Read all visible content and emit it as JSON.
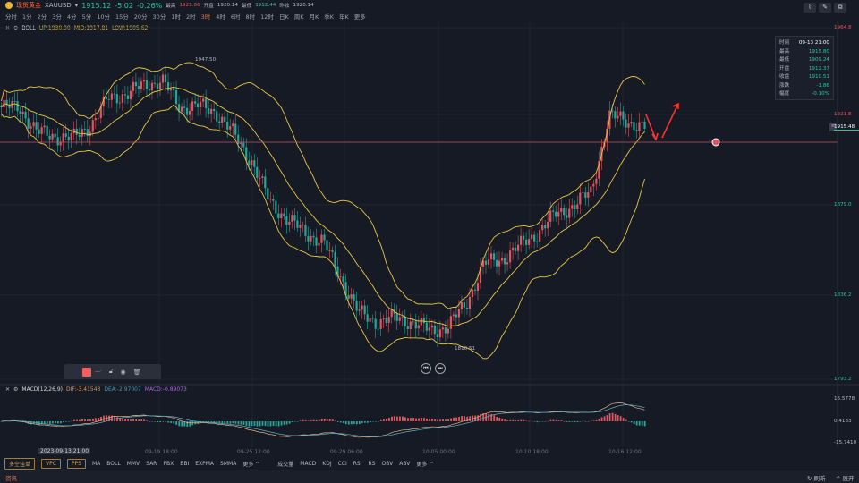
{
  "header": {
    "name": "现货黄金",
    "symbol": "XAUUSD",
    "price": "1915.12",
    "change": "-5.02",
    "change_pct": "-0.26%",
    "high_label": "最高",
    "high": "1921.86",
    "open_label": "开盘",
    "open": "1920.14",
    "low_label": "最低",
    "low": "1912.44",
    "prev_label": "昨收",
    "prev": "1920.14"
  },
  "timeframes": [
    "分时",
    "1分",
    "2分",
    "3分",
    "4分",
    "5分",
    "10分",
    "15分",
    "20分",
    "30分",
    "1时",
    "2时",
    "3时",
    "4时",
    "6时",
    "8时",
    "12时",
    "日K",
    "周K",
    "月K",
    "季K",
    "年K",
    "更多"
  ],
  "active_timeframe": "3时",
  "boll": {
    "name": "BOLL",
    "up": "UP:1930.00",
    "mid": "MID:1917.81",
    "low": "LOW:1905.62"
  },
  "info": {
    "rows": [
      [
        "时间",
        "09-13 21:00"
      ],
      [
        "最高",
        "1915.80"
      ],
      [
        "最低",
        "1909.24"
      ],
      [
        "开盘",
        "1912.37"
      ],
      [
        "收盘",
        "1910.51"
      ],
      [
        "涨跌",
        "-1.86"
      ],
      [
        "幅度",
        "-0.10%"
      ]
    ]
  },
  "price_axis": [
    "1964.8",
    "1921.8",
    "1879.0",
    "1836.2",
    "1793.2"
  ],
  "current_price": "1915.48",
  "annotations": {
    "high": "1947.50",
    "low": "1810.51"
  },
  "macd": {
    "name": "MACD(12,26,9)",
    "dif": "DIF:-3.41543",
    "dea": "DEA:-2.97007",
    "macd": "MACD:-0.89073",
    "axis": [
      "16.5778",
      "0.4183",
      "-15.7410"
    ]
  },
  "time_axis": {
    "cursor": "2023-09-13 21:00",
    "labels": [
      "09-19 18:00",
      "09-25 12:00",
      "09-29 06:00",
      "10-05 00:00",
      "10-10 18:00",
      "10-16 12:00"
    ]
  },
  "bottom": {
    "boxes": [
      "多空挂单",
      "VPC",
      "PPS"
    ],
    "main_ind": [
      "MA",
      "BOLL",
      "MMV",
      "SAR",
      "PBX",
      "BBI",
      "EXPMA",
      "SMMA",
      "更多 ^"
    ],
    "sub_ind": [
      "成交量",
      "MACD",
      "KDJ",
      "CCI",
      "RSI",
      "RS",
      "OBV",
      "ABV",
      "更多 ^"
    ]
  },
  "status": {
    "news": "资讯",
    "refresh": "刷新",
    "expand": "展开"
  },
  "colors": {
    "up": "#e05560",
    "down": "#26a69a",
    "boll": "#e8c840",
    "accent": "#ff6a3a"
  },
  "chart_data": {
    "type": "candlestick",
    "keyframes_close": [
      1925.2,
      1925.2,
      1913.3,
      1911.6,
      1910.3,
      1916.7,
      1929.5,
      1931.6,
      1935.8,
      1938,
      1925.2,
      1926,
      1923.1,
      1912.4,
      1899.7,
      1880.5,
      1872,
      1865.6,
      1861.4,
      1844.4,
      1827.3,
      1823.1,
      1825.2,
      1823.1,
      1818.8,
      1821,
      1831.6,
      1850.7,
      1852.9,
      1859.2,
      1865.6,
      1874.1,
      1878.4,
      1884.8,
      1921,
      1918.8,
      1915.5
    ]
  }
}
